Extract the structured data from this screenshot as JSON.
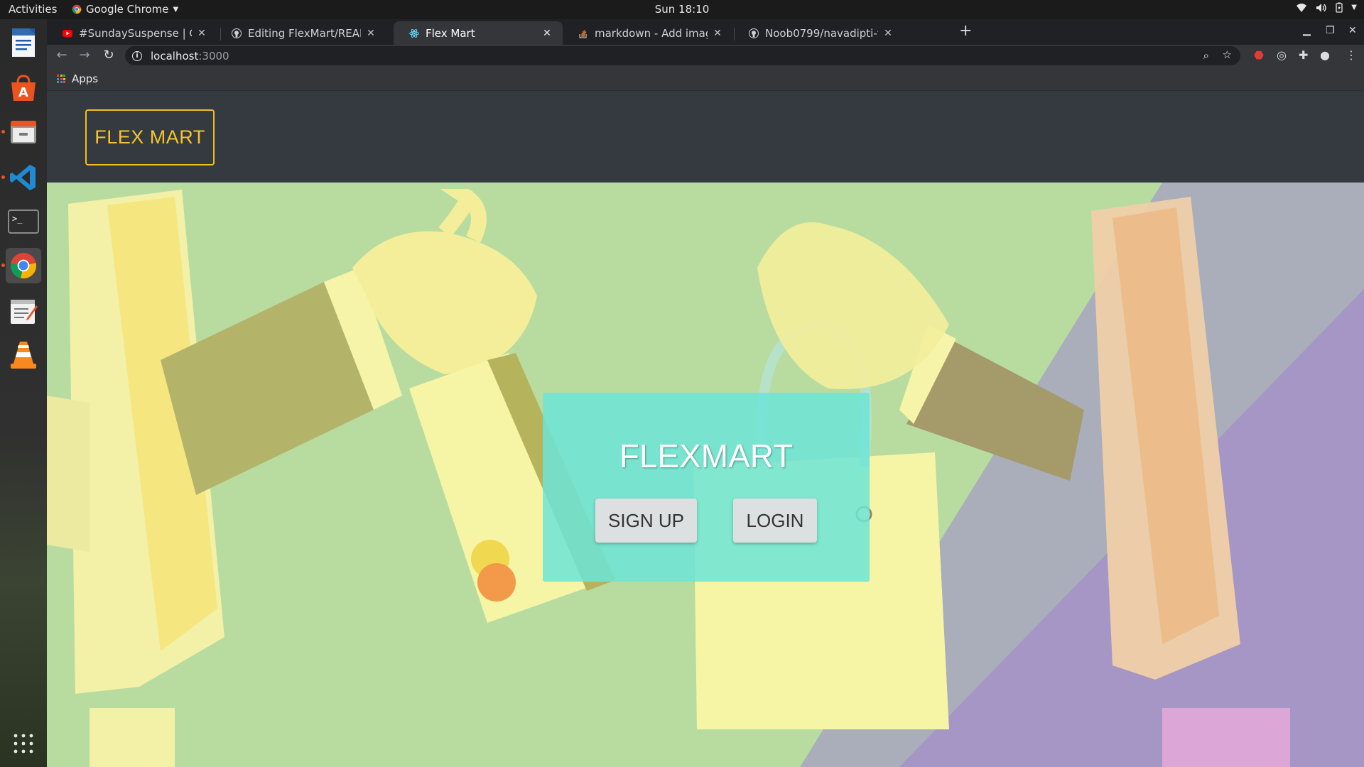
{
  "system": {
    "activities": "Activities",
    "app_name": "Google Chrome",
    "clock": "Sun 18:10"
  },
  "dock": {
    "items": [
      "writer-icon",
      "software-center-icon",
      "files-icon",
      "vscode-icon",
      "terminal-icon",
      "chrome-icon",
      "text-editor-icon",
      "vlc-icon"
    ],
    "apps_grid": "show-applications-icon"
  },
  "browser": {
    "tabs": [
      {
        "title": "#SundaySuspense | Ganat",
        "icon": "youtube-icon",
        "active": false
      },
      {
        "title": "Editing FlexMart/READMI",
        "icon": "github-icon",
        "active": false
      },
      {
        "title": "Flex Mart",
        "icon": "react-icon",
        "active": true
      },
      {
        "title": "markdown - Add images t",
        "icon": "stackoverflow-icon",
        "active": false
      },
      {
        "title": "Noob0799/navadipti-teac",
        "icon": "github-icon",
        "active": false
      }
    ],
    "new_tab": "+",
    "address": {
      "host": "localhost",
      "port": ":3000"
    },
    "bookmarks": {
      "apps": "Apps"
    }
  },
  "page": {
    "brand": "FLEX MART",
    "card": {
      "title": "FLEXMART",
      "signup": "SIGN UP",
      "login": "LOGIN"
    }
  },
  "colors": {
    "navbar": "#343a40",
    "brand": "#f4c430",
    "card": "#6ee4d6",
    "hero_green": "#b8dca0"
  }
}
